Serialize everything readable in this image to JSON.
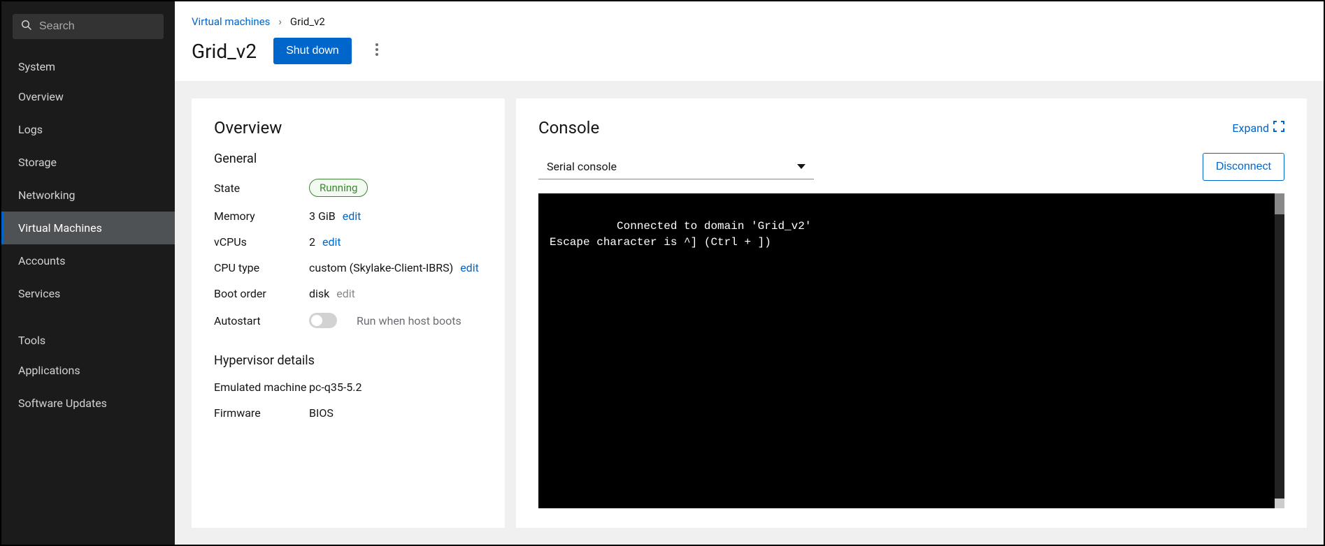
{
  "sidebar": {
    "search_placeholder": "Search",
    "sections": [
      {
        "label": "System",
        "items": [
          {
            "label": "Overview",
            "active": false
          },
          {
            "label": "Logs",
            "active": false
          },
          {
            "label": "Storage",
            "active": false
          },
          {
            "label": "Networking",
            "active": false
          },
          {
            "label": "Virtual Machines",
            "active": true
          },
          {
            "label": "Accounts",
            "active": false
          },
          {
            "label": "Services",
            "active": false
          }
        ]
      },
      {
        "label": "Tools",
        "items": [
          {
            "label": "Applications",
            "active": false
          },
          {
            "label": "Software Updates",
            "active": false
          }
        ]
      }
    ]
  },
  "breadcrumb": {
    "parent": "Virtual machines",
    "current": "Grid_v2"
  },
  "page": {
    "title": "Grid_v2",
    "shutdown_label": "Shut down"
  },
  "overview": {
    "card_title": "Overview",
    "general_title": "General",
    "rows": {
      "state_label": "State",
      "state_value": "Running",
      "memory_label": "Memory",
      "memory_value": "3 GiB",
      "memory_edit": "edit",
      "vcpus_label": "vCPUs",
      "vcpus_value": "2",
      "vcpus_edit": "edit",
      "cputype_label": "CPU type",
      "cputype_value": "custom (Skylake-Client-IBRS)",
      "cputype_edit": "edit",
      "boot_label": "Boot order",
      "boot_value": "disk",
      "boot_edit": "edit",
      "autostart_label": "Autostart",
      "autostart_hint": "Run when host boots"
    },
    "hypervisor_title": "Hypervisor details",
    "hv": {
      "emulated_label": "Emulated machine",
      "emulated_value": "pc-q35-5.2",
      "firmware_label": "Firmware",
      "firmware_value": "BIOS"
    }
  },
  "console": {
    "title": "Console",
    "expand_label": "Expand",
    "select_value": "Serial console",
    "disconnect_label": "Disconnect",
    "output": "Connected to domain 'Grid_v2'\nEscape character is ^] (Ctrl + ])"
  }
}
